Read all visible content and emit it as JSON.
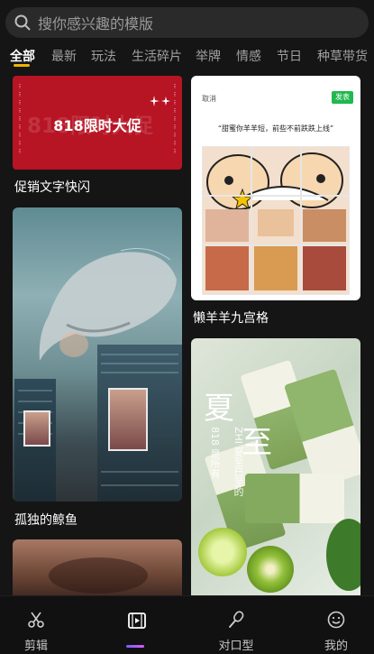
{
  "search": {
    "placeholder": "搜你感兴趣的模版",
    "icon": "search-icon"
  },
  "tabs": [
    {
      "label": "全部",
      "active": true
    },
    {
      "label": "最新"
    },
    {
      "label": "玩法"
    },
    {
      "label": "生活碎片"
    },
    {
      "label": "举牌"
    },
    {
      "label": "情感"
    },
    {
      "label": "节日"
    },
    {
      "label": "种草带货"
    }
  ],
  "templates": [
    {
      "caption": "促销文字快闪",
      "overlay_title": "818限时大促",
      "overlay_ghost": "818限时大促"
    },
    {
      "caption": "懒羊羊九宫格",
      "cancel": "取消",
      "publish": "发表",
      "prompt": "“甜蜜你羊羊短，前些不前跌跌上线”"
    },
    {
      "caption": "孤独的鲸鱼"
    },
    {
      "caption": "",
      "char1": "夏",
      "char2": "至",
      "vline1": "818 是所有",
      "vline2": "ZHI 夏至已至的"
    },
    {
      "caption": ""
    }
  ],
  "nav": [
    {
      "label": "剪辑",
      "icon": "scissors-icon"
    },
    {
      "label": "",
      "icon": "template-icon",
      "active": true
    },
    {
      "label": "对口型",
      "icon": "microphone-icon"
    },
    {
      "label": "我的",
      "icon": "smile-icon"
    }
  ],
  "colors": {
    "accent_tab": "#f0b400",
    "active_nav": "#9b5cff",
    "promo_red": "#b71424",
    "publish_green": "#21b84d"
  }
}
